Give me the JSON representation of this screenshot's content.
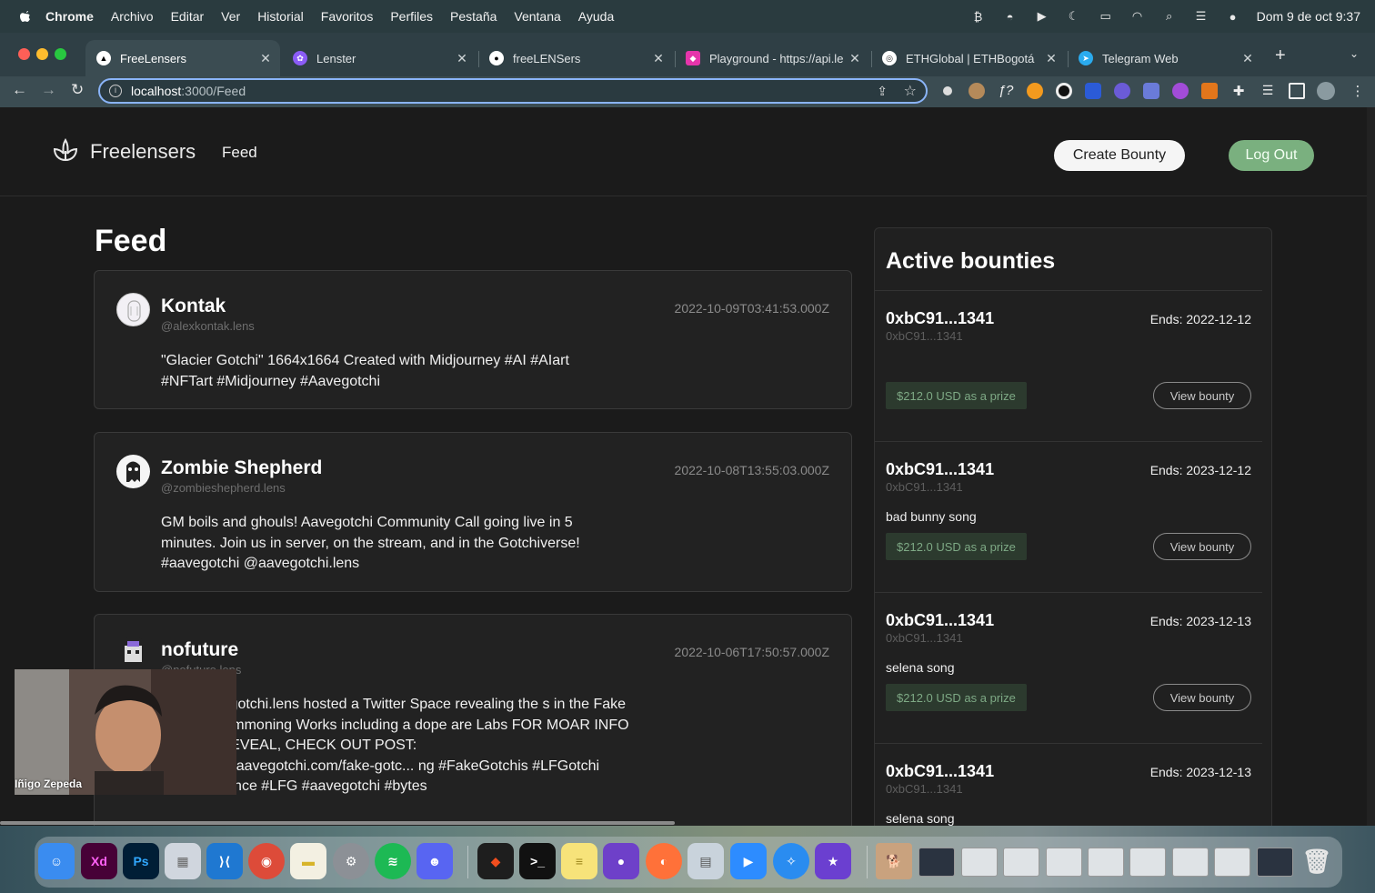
{
  "menubar": {
    "app": "Chrome",
    "items": [
      "Archivo",
      "Editar",
      "Ver",
      "Historial",
      "Favoritos",
      "Perfiles",
      "Pestaña",
      "Ventana",
      "Ayuda"
    ],
    "clock": "Dom 9 de oct  9:37"
  },
  "tabs": [
    {
      "title": "FreeLensers",
      "active": true
    },
    {
      "title": "Lenster",
      "active": false
    },
    {
      "title": "freeLENSers",
      "active": false
    },
    {
      "title": "Playground - https://api.le",
      "active": false
    },
    {
      "title": "ETHGlobal | ETHBogotá",
      "active": false
    },
    {
      "title": "Telegram Web",
      "active": false
    }
  ],
  "address": {
    "host": "localhost",
    "path": ":3000/Feed"
  },
  "header": {
    "brand": "Freelensers",
    "nav_feed": "Feed",
    "create_bounty": "Create Bounty",
    "log_out": "Log Out"
  },
  "feed": {
    "title": "Feed",
    "posts": [
      {
        "name": "Kontak",
        "handle": "@alexkontak.lens",
        "date": "2022-10-09T03:41:53.000Z",
        "content": "\"Glacier Gotchi\" 1664x1664 Created with Midjourney #AI #AIart #NFTart #Midjourney #Aavegotchi"
      },
      {
        "name": "Zombie Shepherd",
        "handle": "@zombieshepherd.lens",
        "date": "2022-10-08T13:55:03.000Z",
        "content": "GM boils and ghouls! Aavegotchi Community Call going live in 5 minutes. Join us in server, on the stream, and in the Gotchiverse! #aavegotchi @aavegotchi.lens"
      },
      {
        "name": "nofuture",
        "handle": "@nofuture.lens",
        "date": "2022-10-06T17:50:57.000Z",
        "content": "ay, @aavegotchi.lens hosted a Twitter Space revealing the s in the Fake Gotchis Summoning Works including a dope are Labs FOR MOAR INFO ON THE REVEAL, CHECK OUT POST: https://blog.aavegotchi.com/fake-gotc... ng #FakeGotchis #LFGotchi #Gotchissance #LFG #aavegotchi #bytes"
      }
    ]
  },
  "bounties": {
    "title": "Active bounties",
    "items": [
      {
        "address": "0xbC91...1341",
        "address_sub": "0xbC91...1341",
        "ends": "Ends: 2022-12-12",
        "description": "",
        "prize": "$212.0 USD as a prize",
        "button": "View bounty"
      },
      {
        "address": "0xbC91...1341",
        "address_sub": "0xbC91...1341",
        "ends": "Ends: 2023-12-12",
        "description": "bad bunny song",
        "prize": "$212.0 USD as a prize",
        "button": "View bounty"
      },
      {
        "address": "0xbC91...1341",
        "address_sub": "0xbC91...1341",
        "ends": "Ends: 2023-12-13",
        "description": "selena song",
        "prize": "$212.0 USD as a prize",
        "button": "View bounty"
      },
      {
        "address": "0xbC91...1341",
        "address_sub": "0xbC91...1341",
        "ends": "Ends: 2023-12-13",
        "description": "selena song",
        "prize": "",
        "button": ""
      }
    ]
  },
  "webcam": {
    "label": "Iñigo Zepeda"
  },
  "colors": {
    "accent_green": "#7ab07f",
    "omnibox_focus": "#8ab4f8"
  }
}
